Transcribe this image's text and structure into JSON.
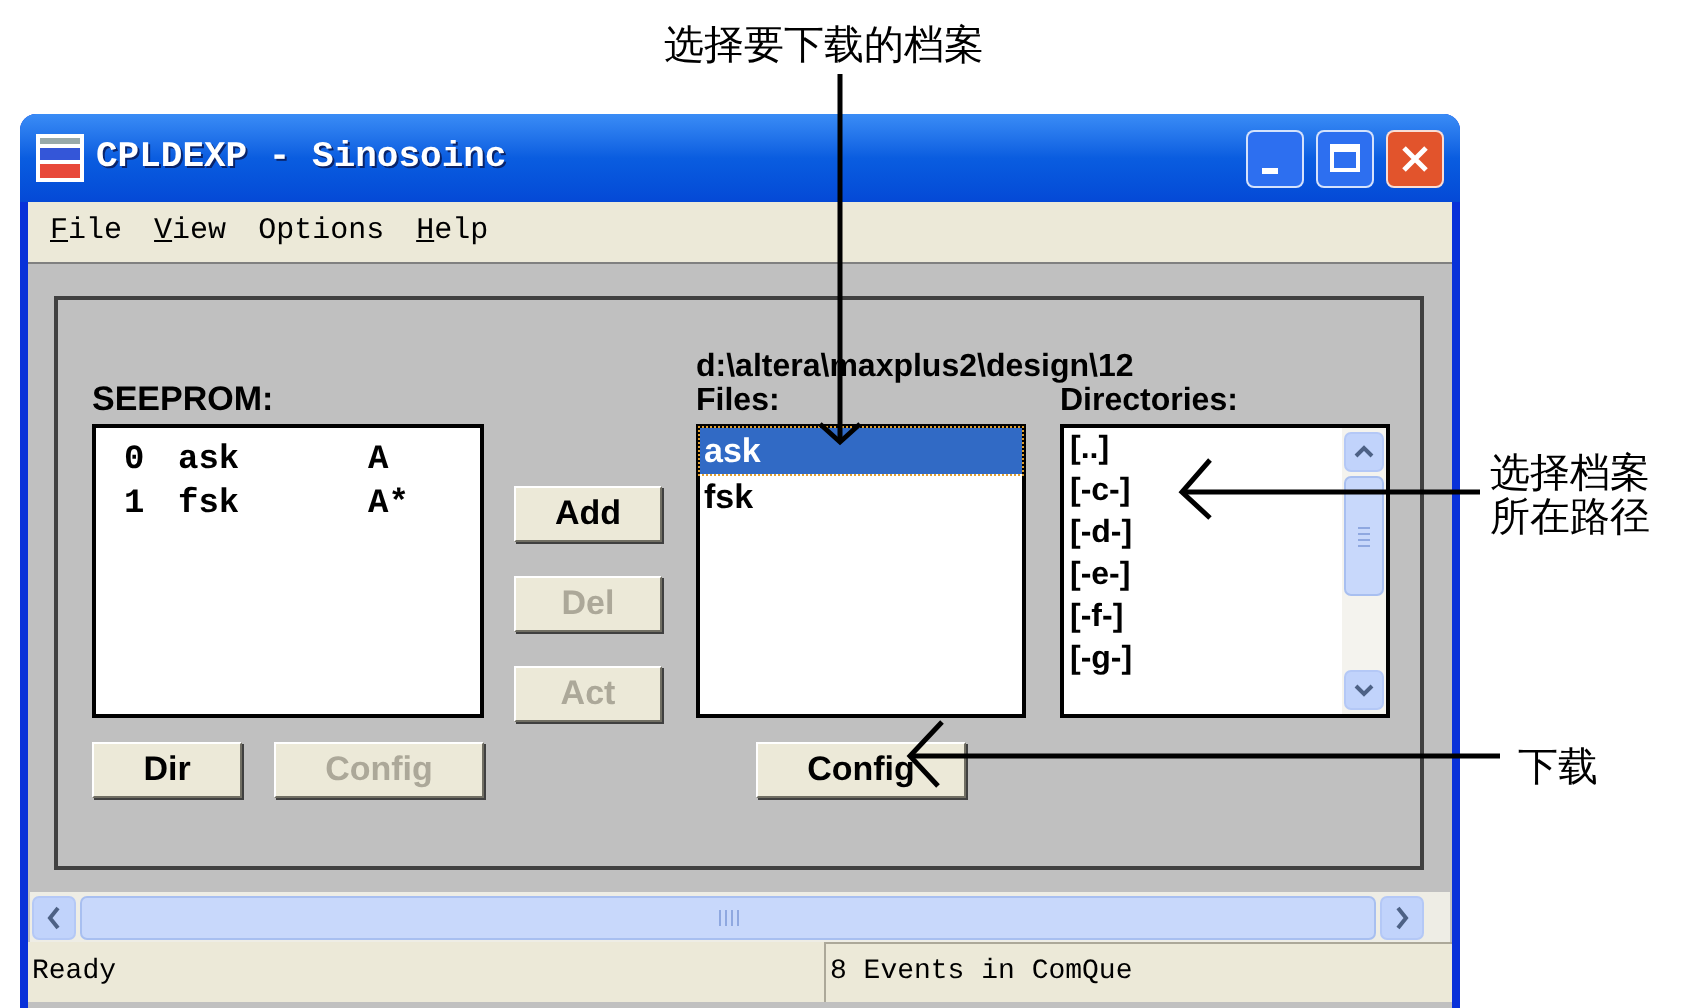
{
  "annotations": [
    {
      "text": "选择要下载的档案"
    },
    {
      "text": "选择档案所在路径"
    },
    {
      "text": "下载"
    }
  ],
  "window": {
    "title": "CPLDEXP - Sinosoinc"
  },
  "menu": [
    {
      "label": "File",
      "underline": true
    },
    {
      "label": "View",
      "underline": true
    },
    {
      "label": "Options",
      "underline": false
    },
    {
      "label": "Help",
      "underline": true
    }
  ],
  "seeprom": {
    "label": "SEEPROM:",
    "entries": [
      {
        "index": "0",
        "name": "ask",
        "flags": "A"
      },
      {
        "index": "1",
        "name": "fsk",
        "flags": "A*"
      }
    ]
  },
  "side_buttons": [
    {
      "label": "Add",
      "disabled": false
    },
    {
      "label": "Del",
      "disabled": true
    },
    {
      "label": "Act",
      "disabled": true
    }
  ],
  "bottom_buttons": [
    {
      "label": "Dir",
      "disabled": false
    },
    {
      "label": "Config",
      "disabled": true
    }
  ],
  "files": {
    "path": "d:\\altera\\maxplus2\\design\\12",
    "label": "Files:",
    "items": [
      {
        "name": "ask",
        "selected": true
      },
      {
        "name": "fsk",
        "selected": false
      }
    ],
    "button": {
      "label": "Config",
      "disabled": false
    }
  },
  "directories": {
    "label": "Directories:",
    "items": [
      "[..]",
      "[-c-]",
      "[-d-]",
      "[-e-]",
      "[-f-]",
      "[-g-]"
    ]
  },
  "status_bar": {
    "message": "Ready",
    "events": "8 Events in ComQue"
  }
}
